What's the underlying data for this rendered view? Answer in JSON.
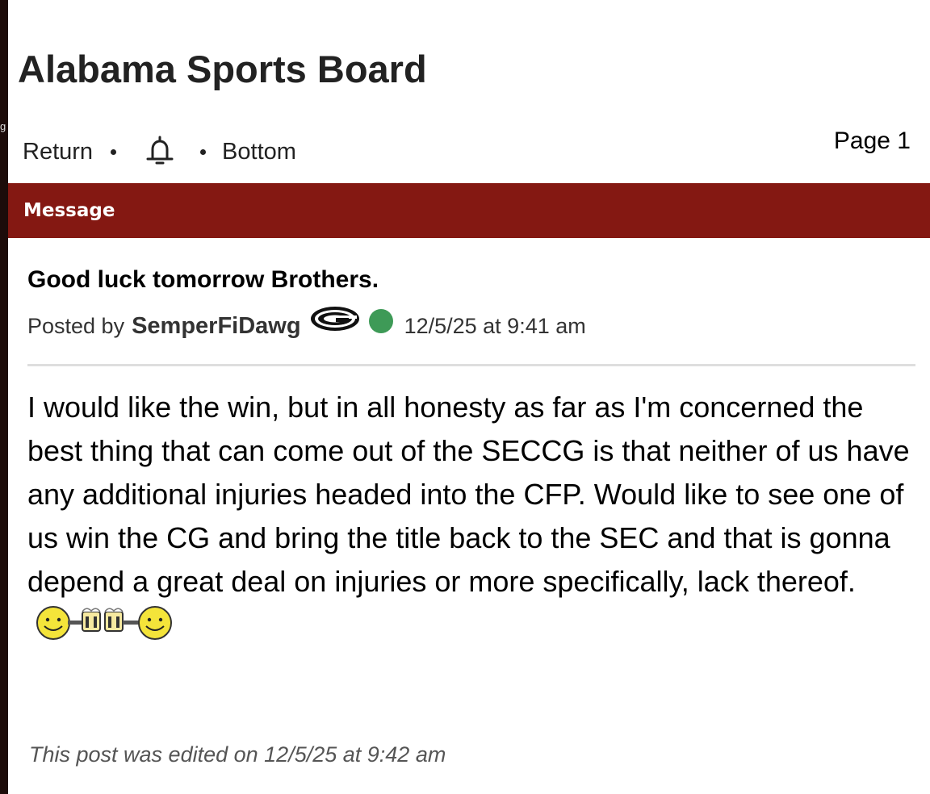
{
  "board": {
    "title": "Alabama Sports Board"
  },
  "left_edge": {
    "glyph": "g"
  },
  "nav": {
    "return_label": "Return",
    "bottom_label": "Bottom",
    "bell_icon": "bell-icon",
    "page_label": "Page 1"
  },
  "header": {
    "label": "Message"
  },
  "post": {
    "title": "Good luck tomorrow Brothers.",
    "posted_by_label": "Posted by",
    "author": "SemperFiDawg",
    "team_logo_icon": "georgia-g-logo-icon",
    "online_status_color": "#3e9a57",
    "timestamp": "12/5/25 at 9:41 am",
    "body": "I would like the win, but in all honesty as far as I'm concerned the best thing that can come out of the SECCG is that neither of us have any additional injuries headed into the CFP. Would like to see one of us win the CG and bring the title back to the SEC and that is gonna depend a great deal on injuries or more specifically, lack thereof.",
    "emoticon_icon": "cheers-emoticon-icon",
    "edit_note": "This post was edited on 12/5/25 at 9:42 am"
  },
  "colors": {
    "header_bar": "#841812",
    "left_edge": "#1d0c0a"
  }
}
